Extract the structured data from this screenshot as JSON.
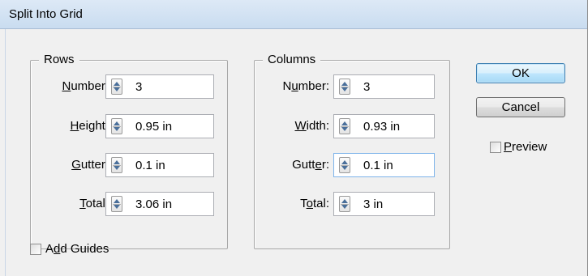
{
  "window": {
    "title": "Split Into Grid"
  },
  "rows": {
    "legend": "Rows",
    "fields": [
      {
        "label_pre": "",
        "label_key": "N",
        "label_post": "umber:",
        "value": "3"
      },
      {
        "label_pre": "",
        "label_key": "H",
        "label_post": "eight:",
        "value": "0.95 in"
      },
      {
        "label_pre": "",
        "label_key": "G",
        "label_post": "utter:",
        "value": "0.1 in"
      },
      {
        "label_pre": "",
        "label_key": "T",
        "label_post": "otal:",
        "value": "3.06 in"
      }
    ]
  },
  "columns": {
    "legend": "Columns",
    "fields": [
      {
        "label_pre": "N",
        "label_key": "u",
        "label_post": "mber:",
        "value": "3"
      },
      {
        "label_pre": "",
        "label_key": "W",
        "label_post": "idth:",
        "value": "0.93 in"
      },
      {
        "label_pre": "Gutt",
        "label_key": "e",
        "label_post": "r:",
        "value": "0.1 in"
      },
      {
        "label_pre": "T",
        "label_key": "o",
        "label_post": "tal:",
        "value": "3 in"
      }
    ]
  },
  "buttons": {
    "ok": "OK",
    "cancel": "Cancel"
  },
  "preview": {
    "label_key": "P",
    "label_post": "review",
    "checked": false
  },
  "add_guides": {
    "label_pre": "A",
    "label_key": "d",
    "label_post": "d Guides",
    "checked": false
  },
  "colors": {
    "accent": "#3c7fb1",
    "titlebar": "#c9dcf0",
    "dialog_bg": "#f0f0f0"
  }
}
